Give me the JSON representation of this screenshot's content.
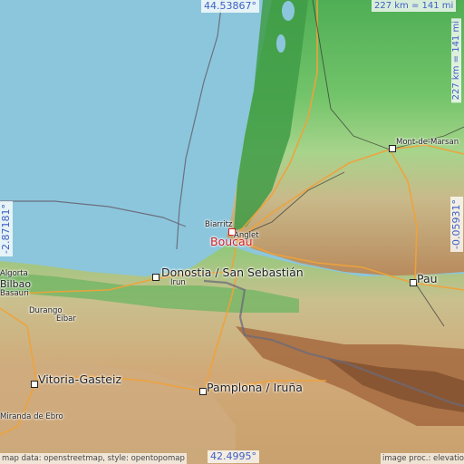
{
  "coordinates": {
    "top": "44.53867°",
    "bottom": "42.4995°",
    "left": "-2.87181°",
    "right": "-0.05931°"
  },
  "scale": {
    "horizontal": "227 km = 141 mi",
    "vertical": "227 km = 141 mi"
  },
  "attribution": {
    "left": "map data: openstreetmap, style: opentopomap",
    "right": "image proc.: elevation.city"
  },
  "highlighted_place": "Boucau",
  "places": {
    "mont_de_marsan": "Mont-de-Marsan",
    "anglet": "Anglet",
    "biarritz": "Biarritz",
    "donostia": "Donostia / San Sebastián",
    "irun": "Irun",
    "pau": "Pau",
    "algorta": "Algorta",
    "bilbao": "Bilbao",
    "basauri": "Basauri",
    "durango": "Durango",
    "eibar": "Eibar",
    "vitoria": "Vitoria-Gasteiz",
    "pamplona": "Pamplona / Iruña",
    "miranda": "Miranda de Ebro"
  },
  "colors": {
    "sea": "#8cc6dc",
    "lowland": "#5cb85a",
    "hills": "#a8d68c",
    "mountains": "#b5824f",
    "highlight": "#d21f2a",
    "coord_text": "#3d5fc4"
  }
}
